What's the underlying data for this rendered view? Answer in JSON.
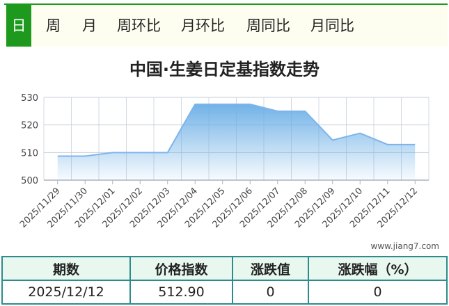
{
  "tabs": [
    {
      "label": "日",
      "active": true
    },
    {
      "label": "周"
    },
    {
      "label": "月"
    },
    {
      "label": "周环比"
    },
    {
      "label": "月环比"
    },
    {
      "label": "周同比"
    },
    {
      "label": "月同比"
    }
  ],
  "colors": {
    "accent": "#1d9a1d",
    "line": "#7cb5ec",
    "grid": "#c0cad6",
    "table_border": "#2e8b8b"
  },
  "chart_data": {
    "type": "area",
    "title": "中国·生姜日定基指数走势",
    "x": [
      "2025/11/29",
      "2025/11/30",
      "2025/12/01",
      "2025/12/02",
      "2025/12/03",
      "2025/12/04",
      "2025/12/05",
      "2025/12/06",
      "2025/12/07",
      "2025/12/08",
      "2025/12/09",
      "2025/12/10",
      "2025/12/11",
      "2025/12/12"
    ],
    "series": [
      {
        "values": [
          508.7,
          508.7,
          510.0,
          510.0,
          510.0,
          527.5,
          527.5,
          527.5,
          525.0,
          525.0,
          514.5,
          517.0,
          512.9,
          512.9
        ]
      }
    ],
    "ylim": [
      500,
      530
    ],
    "yticks": [
      500,
      510,
      520,
      530
    ],
    "grid": true
  },
  "watermark": "www.jiang7.com",
  "table": {
    "headers": [
      "期数",
      "价格指数",
      "涨跌值",
      "涨跌幅（%）"
    ],
    "row": [
      "2025/12/12",
      "512.90",
      "0",
      "0"
    ]
  }
}
